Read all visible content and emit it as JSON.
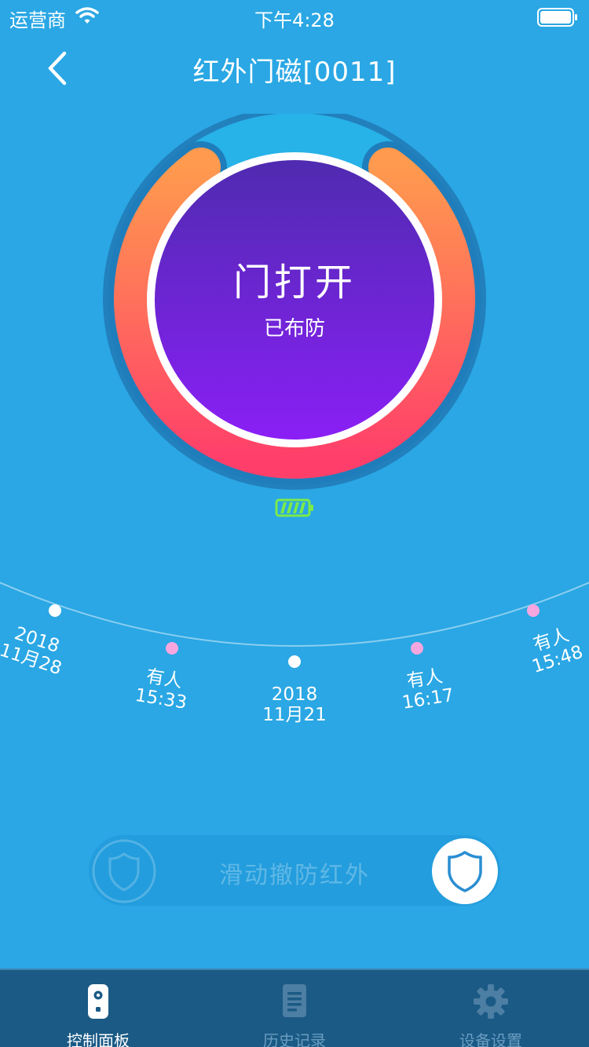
{
  "status_bar": {
    "carrier": "运营商",
    "time": "下午4:28"
  },
  "header": {
    "title": "红外门磁[0011]"
  },
  "dial": {
    "door_state": "门打开",
    "arm_state": "已布防"
  },
  "timeline": {
    "items": [
      {
        "line1": "2018",
        "line2": "11月28",
        "dot": "white"
      },
      {
        "line1": "有人",
        "line2": "15:33",
        "dot": "pink"
      },
      {
        "line1": "2018",
        "line2": "11月21",
        "dot": "white"
      },
      {
        "line1": "有人",
        "line2": "16:17",
        "dot": "pink"
      },
      {
        "line1": "有人",
        "line2": "15:48",
        "dot": "pink"
      }
    ]
  },
  "slider": {
    "label": "滑动撤防红外"
  },
  "tabs": [
    {
      "label": "控制面板",
      "icon": "remote-icon",
      "active": true
    },
    {
      "label": "历史记录",
      "icon": "document-icon",
      "active": false
    },
    {
      "label": "设备设置",
      "icon": "gear-icon",
      "active": false
    }
  ],
  "colors": {
    "background": "#2aa7e4",
    "ring_start": "#ff9a4e",
    "ring_end": "#ff3f6a",
    "inner_start": "#4f2bb0",
    "inner_end": "#8a1ff5",
    "dot_pink": "#f7a6e0",
    "tab_bar": "#1a5a85",
    "battery": "#7bea4a"
  }
}
